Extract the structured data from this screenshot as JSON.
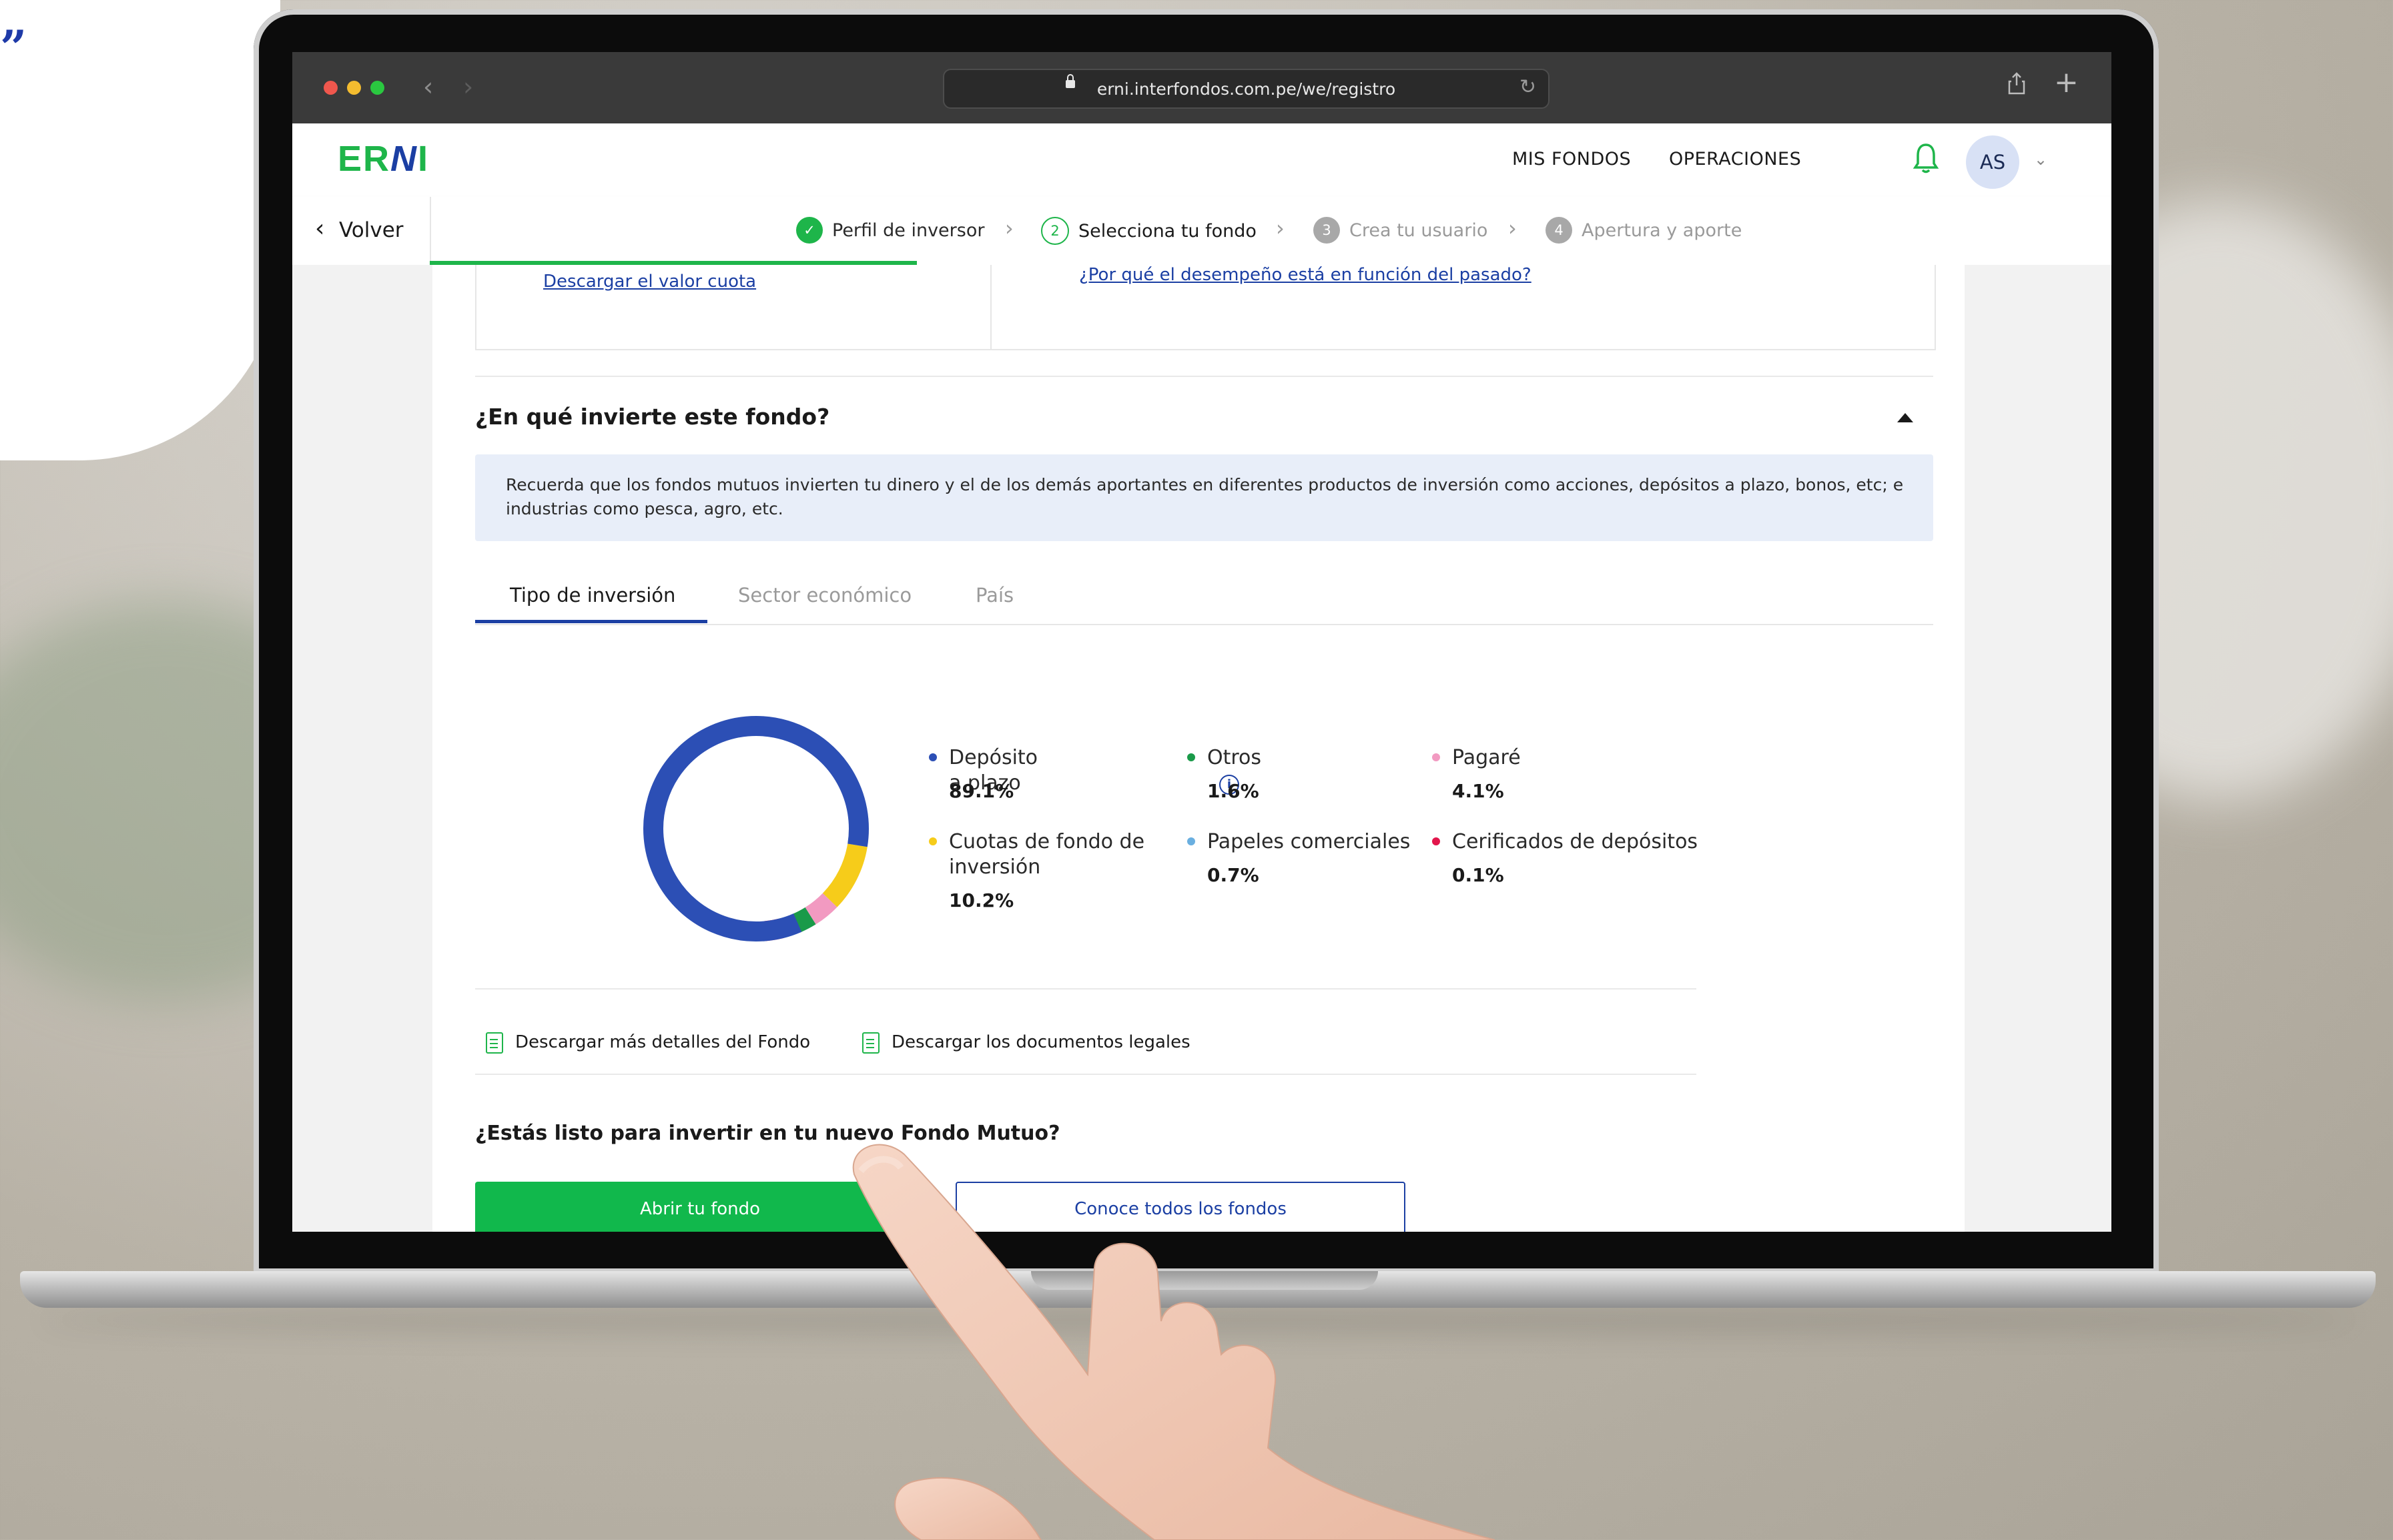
{
  "browser": {
    "url": "erni.interfondos.com.pe/we/registro"
  },
  "header": {
    "logo": "ERNI",
    "menu": [
      "MIS FONDOS",
      "OPERACIONES"
    ],
    "avatar_initials": "AS"
  },
  "stepper": {
    "back_label": "Volver",
    "steps": [
      {
        "number": "✓",
        "label": "Perfil de inversor",
        "state": "done"
      },
      {
        "number": "2",
        "label": "Selecciona tu fondo",
        "state": "current"
      },
      {
        "number": "3",
        "label": "Crea tu usuario",
        "state": "pending"
      },
      {
        "number": "4",
        "label": "Apertura y aporte",
        "state": "pending"
      }
    ]
  },
  "top_card": {
    "left_link": "Descargar el valor cuota",
    "right_link": "¿Por qué el desempeño está en función del pasado?"
  },
  "section": {
    "title": "¿En qué invierte este fondo?",
    "info": "Recuerda que los fondos mutuos invierten tu dinero y el de los demás aportantes en diferentes productos de inversión como acciones, depósitos a plazo, bonos, etc; e industrias como pesca, agro, etc."
  },
  "tabs": [
    "Tipo de inversión",
    "Sector económico",
    "País"
  ],
  "chart_data": {
    "type": "pie",
    "categories": [
      "Depósito a plazo",
      "Otros",
      "Pagaré",
      "Cuotas de fondo de inversión",
      "Papeles comerciales",
      "Cerificados de depósitos"
    ],
    "values": [
      89.1,
      1.6,
      4.1,
      10.2,
      0.7,
      0.1
    ],
    "value_labels": [
      "89.1%",
      "1.6%",
      "4.1%",
      "10.2%",
      "0.7%",
      "0.1%"
    ],
    "colors": [
      "#2c4fb5",
      "#1a9a49",
      "#f29ac1",
      "#f6cc1a",
      "#6aafe0",
      "#e2164b"
    ]
  },
  "downloads": [
    "Descargar más detalles del Fondo",
    "Descargar los documentos legales"
  ],
  "cta": {
    "question": "¿Estás listo para invertir en tu nuevo Fondo Mutuo?",
    "primary": "Abrir tu fondo",
    "secondary": "Conoce todos los fondos"
  },
  "colors": {
    "brand_green": "#1eb54a",
    "brand_blue": "#1b3fa3"
  }
}
